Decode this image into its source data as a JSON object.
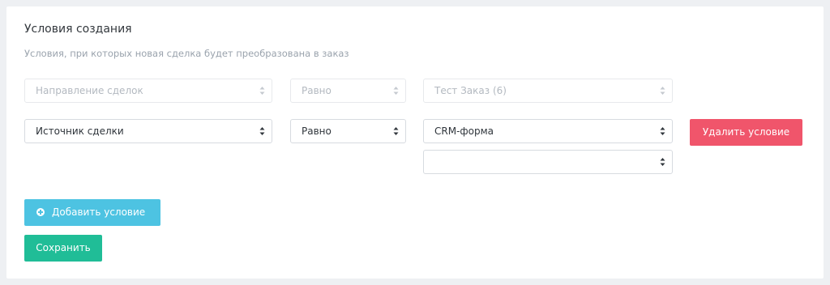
{
  "section": {
    "title": "Условия создания",
    "subtitle": "Условия, при которых новая сделка будет преобразована в заказ"
  },
  "conditions": [
    {
      "field": "Направление сделок",
      "operator": "Равно",
      "value": "Тест Заказ (6)",
      "disabled": true
    },
    {
      "field": "Источник сделки",
      "operator": "Равно",
      "value": "CRM-форма",
      "extra_value": "",
      "disabled": false
    }
  ],
  "buttons": {
    "delete_label": "Удалить условие",
    "add_label": "Добавить условие",
    "save_label": "Сохранить"
  },
  "colors": {
    "delete": "#f0556b",
    "add": "#4dc3e2",
    "save": "#20bd97"
  },
  "icons": {
    "select_arrows": "sort-arrows-icon",
    "add": "plus-circle-icon"
  }
}
